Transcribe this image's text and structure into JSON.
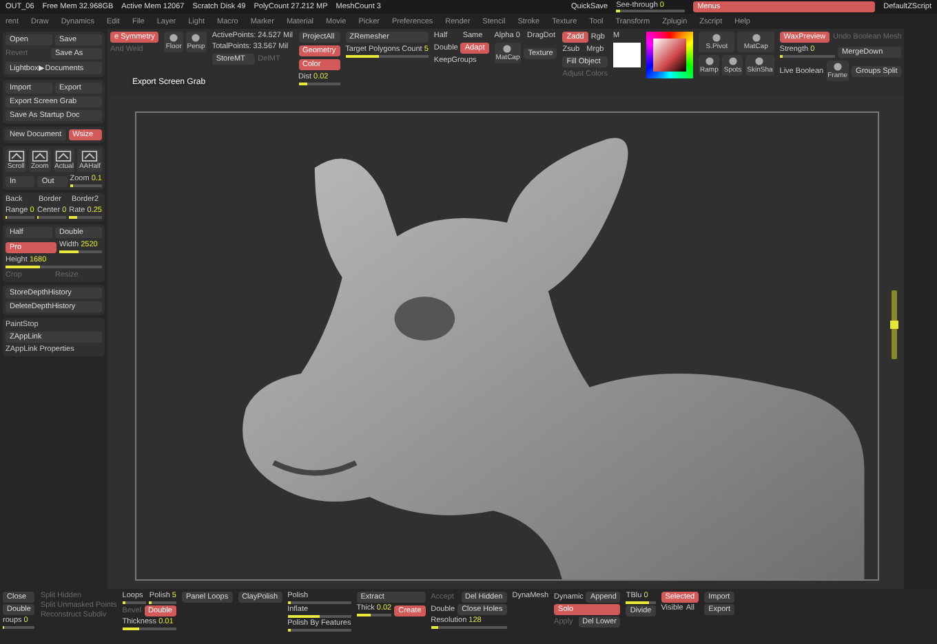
{
  "status_bar": {
    "app": "OUT_06",
    "items": [
      "Free Mem 32.968GB",
      "Active Mem 12067",
      "Scratch Disk 49",
      "PolyCount 27.212 MP",
      "MeshCount 3"
    ],
    "quicksave": "QuickSave",
    "see_through": {
      "label": "See-through",
      "value": "0",
      "level": 0.05
    },
    "menus": {
      "label": "Menus",
      "selected": true
    },
    "script": "DefaultZScript"
  },
  "menu_bar": [
    "rent",
    "Draw",
    "Dynamics",
    "Edit",
    "File",
    "Layer",
    "Light",
    "Macro",
    "Marker",
    "Material",
    "Movie",
    "Picker",
    "Preferences",
    "Render",
    "Stencil",
    "Stroke",
    "Texture",
    "Tool",
    "Transform",
    "Zplugin",
    "Zscript",
    "Help"
  ],
  "left_panel": [
    [
      [
        {
          "kind": "button",
          "label": "Open",
          "selected": false
        },
        {
          "kind": "button",
          "label": "Save",
          "selected": false
        }
      ],
      [
        {
          "kind": "muted",
          "label": "Revert"
        },
        {
          "kind": "button",
          "label": "Save As",
          "selected": false
        }
      ],
      [
        {
          "kind": "button",
          "label": "Lightbox▶Documents",
          "selected": false
        }
      ]
    ],
    [
      [
        {
          "kind": "button",
          "label": "Import",
          "selected": false
        },
        {
          "kind": "button",
          "label": "Export",
          "selected": false
        }
      ],
      [
        {
          "kind": "button",
          "label": "Export Screen Grab",
          "selected": false
        }
      ],
      [
        {
          "kind": "button",
          "label": "Save As Startup Doc",
          "selected": false
        }
      ]
    ],
    [
      [
        {
          "kind": "button",
          "label": "New Document",
          "selected": false
        },
        {
          "kind": "button",
          "label": "Wsize",
          "selected": true
        }
      ]
    ],
    [
      [
        {
          "kind": "icon",
          "label": "Scroll"
        },
        {
          "kind": "icon",
          "label": "Zoom"
        },
        {
          "kind": "icon",
          "label": "Actual"
        },
        {
          "kind": "icon",
          "label": "AAHalf"
        }
      ],
      [
        {
          "kind": "button",
          "label": "In",
          "selected": false
        },
        {
          "kind": "button",
          "label": "Out",
          "selected": false
        },
        {
          "kind": "slider",
          "label": "Zoom",
          "value": "0.1",
          "level": 0.1
        }
      ]
    ],
    [
      [
        {
          "kind": "text",
          "label": "Back"
        },
        {
          "kind": "text",
          "label": "Border"
        },
        {
          "kind": "text",
          "label": "Border2"
        }
      ],
      [
        {
          "kind": "slider",
          "label": "Range",
          "value": "0",
          "level": 0.05
        },
        {
          "kind": "slider",
          "label": "Center",
          "value": "0",
          "level": 0.05
        },
        {
          "kind": "slider",
          "label": "Rate",
          "value": "0.25",
          "level": 0.25
        }
      ]
    ],
    [
      [
        {
          "kind": "button",
          "label": "Half",
          "selected": false
        },
        {
          "kind": "button",
          "label": "Double",
          "selected": false
        }
      ],
      [
        {
          "kind": "button",
          "label": "Pro",
          "selected": true
        },
        {
          "kind": "slider",
          "label": "Width",
          "value": "2520",
          "level": 0.45
        }
      ],
      [
        {
          "kind": "slider",
          "label": "Height",
          "value": "1680",
          "level": 0.35
        }
      ],
      [
        {
          "kind": "muted",
          "label": "Crop"
        },
        {
          "kind": "muted",
          "label": "Resize"
        }
      ]
    ],
    [
      [
        {
          "kind": "button",
          "label": "StoreDepthHistory",
          "selected": false
        }
      ],
      [
        {
          "kind": "button",
          "label": "DeleteDepthHistory",
          "selected": false
        }
      ]
    ],
    [
      [
        {
          "kind": "text",
          "label": "PaintStop"
        }
      ],
      [
        {
          "kind": "button",
          "label": "ZAppLink",
          "selected": false
        }
      ],
      [
        {
          "kind": "text",
          "label": "ZAppLink Properties"
        }
      ]
    ]
  ],
  "toolbar": [
    [
      [
        {
          "kind": "button",
          "label": "e Symmetry",
          "selected": true
        }
      ],
      [
        {
          "kind": "muted",
          "label": "And Weld"
        }
      ]
    ],
    [
      [
        {
          "kind": "icon",
          "label": "Floor"
        },
        {
          "kind": "icon",
          "label": "Persp"
        }
      ]
    ],
    [
      [
        {
          "kind": "text",
          "label": "ActivePoints: 24.527 Mil"
        }
      ],
      [
        {
          "kind": "text",
          "label": "TotalPoints: 33.567 Mil"
        }
      ],
      [
        {
          "kind": "button",
          "label": "StoreMT",
          "selected": false
        },
        {
          "kind": "muted",
          "label": "DelMT"
        }
      ]
    ],
    [
      [
        {
          "kind": "button",
          "label": "ProjectAll",
          "selected": false
        }
      ],
      [
        {
          "kind": "button",
          "label": "Geometry",
          "selected": true
        }
      ],
      [
        {
          "kind": "button",
          "label": "Color",
          "selected": true
        }
      ],
      [
        {
          "kind": "slider",
          "label": "Dist",
          "value": "0.02",
          "level": 0.2
        }
      ]
    ],
    [
      [
        {
          "kind": "button",
          "label": "ZRemesher",
          "selected": false
        }
      ],
      [
        {
          "kind": "slider",
          "label": "Target Polygons Count",
          "value": "5",
          "level": 0.4
        }
      ]
    ],
    [
      [
        {
          "kind": "text",
          "label": "Half"
        },
        {
          "kind": "text",
          "label": "Same"
        }
      ],
      [
        {
          "kind": "text",
          "label": "Double"
        },
        {
          "kind": "button",
          "label": "Adapt",
          "selected": true
        }
      ],
      [
        {
          "kind": "text",
          "label": "KeepGroups"
        }
      ]
    ],
    [
      [
        {
          "kind": "text",
          "label": "Alpha 0"
        },
        {
          "kind": "text",
          "label": "DragDot"
        }
      ],
      [
        {
          "kind": "icon",
          "label": "MatCap"
        },
        {
          "kind": "button",
          "label": "Texture",
          "selected": false
        }
      ]
    ],
    [
      [
        {
          "kind": "button",
          "label": "Zadd",
          "selected": true
        },
        {
          "kind": "text",
          "label": "Rgb"
        }
      ],
      [
        {
          "kind": "text",
          "label": "Zsub"
        },
        {
          "kind": "text",
          "label": "Mrgb"
        }
      ],
      [
        {
          "kind": "button",
          "label": "Fill Object",
          "selected": false
        }
      ],
      [
        {
          "kind": "muted",
          "label": "Adjust Colors"
        }
      ]
    ],
    [
      [
        {
          "kind": "text",
          "label": "M"
        }
      ],
      [
        {
          "kind": "swatch"
        }
      ]
    ],
    [
      [
        {
          "kind": "picker"
        }
      ]
    ],
    [
      [
        {
          "kind": "icon",
          "label": "S.Pivot"
        },
        {
          "kind": "icon",
          "label": "MatCap"
        }
      ],
      [
        {
          "kind": "icon",
          "label": "Ramp"
        },
        {
          "kind": "icon",
          "label": "Spots"
        },
        {
          "kind": "icon",
          "label": "SkinSha"
        }
      ]
    ],
    [
      [
        {
          "kind": "button",
          "label": "WaxPreview",
          "selected": true
        },
        {
          "kind": "muted",
          "label": "Undo Boolean Mesh"
        }
      ],
      [
        {
          "kind": "slider",
          "label": "Strength",
          "value": "0",
          "level": 0.05
        },
        {
          "kind": "button",
          "label": "MergeDown",
          "selected": false
        }
      ],
      [
        {
          "kind": "text",
          "label": "Live Boolean"
        },
        {
          "kind": "icon",
          "label": "Frame"
        },
        {
          "kind": "button",
          "label": "Groups Split",
          "selected": false
        }
      ]
    ]
  ],
  "tooltip": "Export Screen Grab",
  "bottom_bar": [
    [
      [
        {
          "kind": "button",
          "label": "Close",
          "selected": false
        }
      ],
      [
        {
          "kind": "button",
          "label": "Double",
          "selected": false
        }
      ],
      [
        {
          "kind": "slider",
          "label": "roups",
          "value": "0",
          "level": 0.05
        }
      ]
    ],
    [
      [
        {
          "kind": "muted",
          "label": "Split Hidden"
        }
      ],
      [
        {
          "kind": "muted",
          "label": "Split Unmasked Points"
        }
      ],
      [
        {
          "kind": "muted",
          "label": "Reconstruct Subdiv"
        }
      ]
    ],
    [
      [
        {
          "kind": "slider",
          "label": "Loops",
          "level": 0.1
        },
        {
          "kind": "slider",
          "label": "Polish",
          "value": "5",
          "level": 0.1
        }
      ],
      [
        {
          "kind": "muted",
          "label": "Bevel"
        },
        {
          "kind": "button",
          "label": "Double",
          "selected": true
        }
      ],
      [
        {
          "kind": "slider",
          "label": "Thickness",
          "value": "0.01",
          "level": 0.3
        }
      ]
    ],
    [
      [
        {
          "kind": "button",
          "label": "Panel Loops",
          "selected": false
        }
      ]
    ],
    [
      [
        {
          "kind": "button",
          "label": "ClayPolish",
          "selected": false
        }
      ]
    ],
    [
      [
        {
          "kind": "slider",
          "label": "Polish",
          "level": 0.05
        }
      ],
      [
        {
          "kind": "slider",
          "label": "Inflate",
          "level": 0.5
        }
      ],
      [
        {
          "kind": "slider",
          "label": "Polish By Features",
          "level": 0.05
        }
      ]
    ],
    [
      [
        {
          "kind": "button",
          "label": "Extract",
          "selected": false
        }
      ],
      [
        {
          "kind": "slider",
          "label": "Thick",
          "value": "0.02",
          "level": 0.4
        },
        {
          "kind": "button",
          "label": "Create",
          "selected": true
        }
      ]
    ],
    [
      [
        {
          "kind": "muted",
          "label": "Accept"
        },
        {
          "kind": "button",
          "label": "Del Hidden",
          "selected": false
        }
      ],
      [
        {
          "kind": "text",
          "label": "Double"
        },
        {
          "kind": "button",
          "label": "Close Holes",
          "selected": false
        }
      ],
      [
        {
          "kind": "slider",
          "label": "Resolution",
          "value": "128",
          "level": 0.1
        }
      ]
    ],
    [
      [
        {
          "kind": "text",
          "label": "DynaMesh"
        }
      ]
    ],
    [
      [
        {
          "kind": "text",
          "label": "Dynamic"
        },
        {
          "kind": "button",
          "label": "Append",
          "selected": false
        }
      ],
      [
        {
          "kind": "button",
          "label": "Solo",
          "selected": true
        }
      ],
      [
        {
          "kind": "muted",
          "label": "Apply"
        },
        {
          "kind": "button",
          "label": "Del Lower",
          "selected": false
        }
      ]
    ],
    [
      [
        {
          "kind": "slider",
          "label": "TBlu",
          "value": "0",
          "level": 0.8
        }
      ],
      [
        {
          "kind": "button",
          "label": "Divide",
          "selected": false
        }
      ]
    ],
    [
      [
        {
          "kind": "button",
          "label": "Selected",
          "selected": true
        }
      ],
      [
        {
          "kind": "text",
          "label": "Visible"
        },
        {
          "kind": "text",
          "label": "All"
        }
      ]
    ],
    [
      [
        {
          "kind": "button",
          "label": "Import",
          "selected": false
        }
      ],
      [
        {
          "kind": "button",
          "label": "Export",
          "selected": false
        }
      ]
    ]
  ]
}
